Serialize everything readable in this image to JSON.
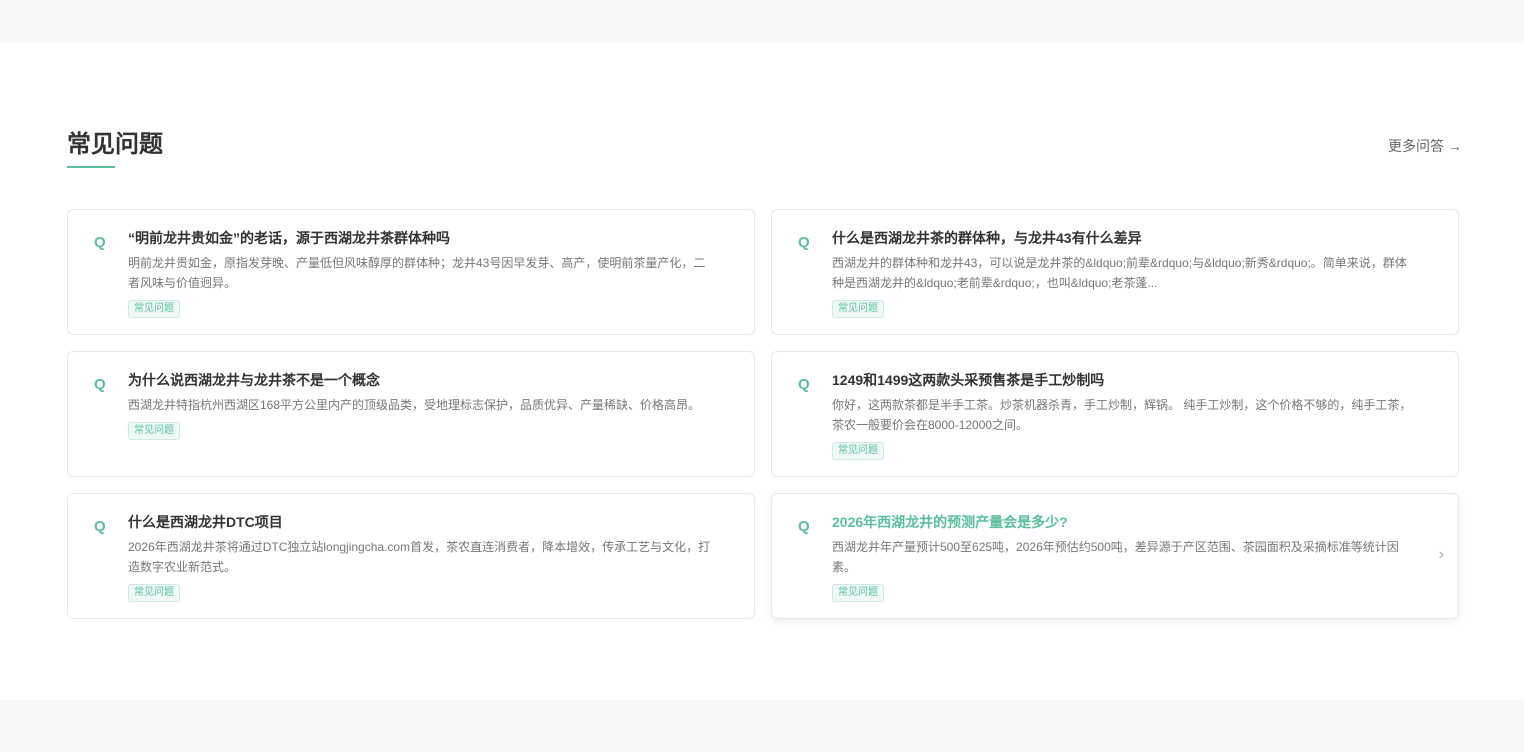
{
  "section": {
    "title": "常见问题",
    "more_label": "更多问答 →"
  },
  "faqs": [
    {
      "title": "“明前龙井贵如金”的老话，源于西湖龙井茶群体种吗",
      "desc": "明前龙井贵如金，原指发芽晚、产量低但风味醇厚的群体种；龙井43号因早发芽、高产，使明前茶量产化，二者风味与价值迥异。",
      "tag": "常见问题"
    },
    {
      "title": "什么是西湖龙井茶的群体种，与龙井43有什么差异",
      "desc": "西湖龙井的群体种和龙井43，可以说是龙井茶的&ldquo;前辈&rdquo;与&ldquo;新秀&rdquo;。简单来说，群体种是西湖龙井的&ldquo;老前辈&rdquo;，也叫&ldquo;老茶蓬...",
      "tag": "常见问题"
    },
    {
      "title": "为什么说西湖龙井与龙井茶不是一个概念",
      "desc": "西湖龙井特指杭州西湖区168平方公里内产的顶级品类，受地理标志保护，品质优异、产量稀缺、价格高昂。",
      "tag": "常见问题"
    },
    {
      "title": "1249和1499这两款头采预售茶是手工炒制吗",
      "desc": "你好，这两款茶都是半手工茶。炒茶机器杀青，手工炒制，辉锅。 纯手工炒制，这个价格不够的，纯手工茶，茶农一般要价会在8000-12000之间。",
      "tag": "常见问题"
    },
    {
      "title": "什么是西湖龙井DTC项目",
      "desc": "2026年西湖龙井茶将通过DTC独立站longjingcha.com首发，茶农直连消费者，降本增效，传承工艺与文化，打造数字农业新范式。",
      "tag": "常见问题"
    },
    {
      "title": "2026年西湖龙井的预测产量会是多少?",
      "desc": "西湖龙井年产量预计500至625吨，2026年预估约500吨，差异源于产区范围、茶园面积及采摘标准等统计因素。",
      "tag": "常见问题"
    }
  ],
  "colors": {
    "accent": "#5bbf9f"
  }
}
